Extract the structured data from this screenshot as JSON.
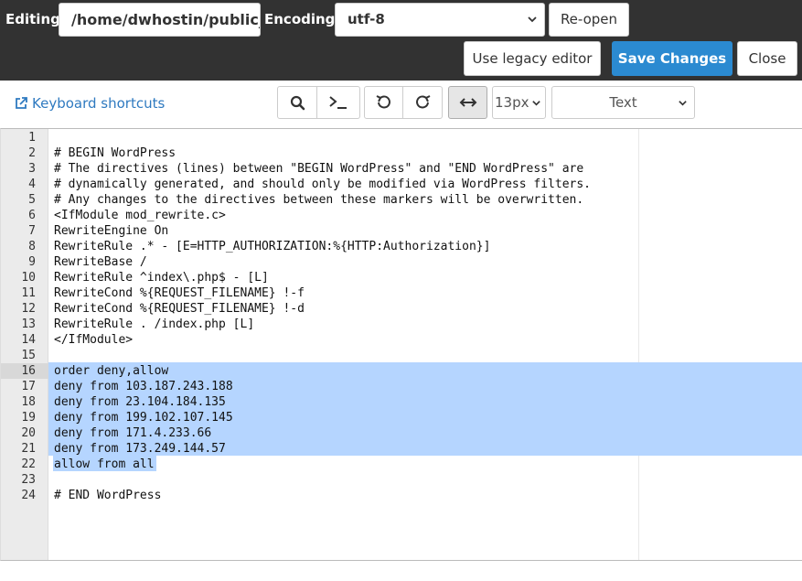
{
  "header": {
    "editing_label": "Editing:",
    "path_value": "/home/dwhostin/public_",
    "encoding_label": "Encoding:",
    "encoding_value": "utf-8",
    "reopen_label": "Re-open",
    "legacy_label": "Use legacy editor",
    "save_label": "Save Changes",
    "close_label": "Close"
  },
  "toolbar": {
    "keyboard_shortcuts": "Keyboard shortcuts",
    "font_size": "13px",
    "mode": "Text"
  },
  "colors": {
    "header_bg": "#323232",
    "save_button": "#2b8ad1",
    "link": "#2f7ac0",
    "selection": "#b5d5ff"
  },
  "editor": {
    "lines": [
      {
        "n": "1",
        "text": ""
      },
      {
        "n": "2",
        "text": "# BEGIN WordPress"
      },
      {
        "n": "3",
        "text": "# The directives (lines) between \"BEGIN WordPress\" and \"END WordPress\" are"
      },
      {
        "n": "4",
        "text": "# dynamically generated, and should only be modified via WordPress filters."
      },
      {
        "n": "5",
        "text": "# Any changes to the directives between these markers will be overwritten."
      },
      {
        "n": "6",
        "text": "<IfModule mod_rewrite.c>"
      },
      {
        "n": "7",
        "text": "RewriteEngine On"
      },
      {
        "n": "8",
        "text": "RewriteRule .* - [E=HTTP_AUTHORIZATION:%{HTTP:Authorization}]"
      },
      {
        "n": "9",
        "text": "RewriteBase /"
      },
      {
        "n": "10",
        "text": "RewriteRule ^index\\.php$ - [L]"
      },
      {
        "n": "11",
        "text": "RewriteCond %{REQUEST_FILENAME} !-f"
      },
      {
        "n": "12",
        "text": "RewriteCond %{REQUEST_FILENAME} !-d"
      },
      {
        "n": "13",
        "text": "RewriteRule . /index.php [L]"
      },
      {
        "n": "14",
        "text": "</IfModule>"
      },
      {
        "n": "15",
        "text": ""
      },
      {
        "n": "16",
        "text": "order deny,allow"
      },
      {
        "n": "17",
        "text": "deny from 103.187.243.188"
      },
      {
        "n": "18",
        "text": "deny from 23.104.184.135"
      },
      {
        "n": "19",
        "text": "deny from 199.102.107.145"
      },
      {
        "n": "20",
        "text": "deny from 171.4.233.66"
      },
      {
        "n": "21",
        "text": "deny from 173.249.144.57"
      },
      {
        "n": "22",
        "text": "allow from all"
      },
      {
        "n": "23",
        "text": ""
      },
      {
        "n": "24",
        "text": "# END WordPress"
      }
    ]
  }
}
